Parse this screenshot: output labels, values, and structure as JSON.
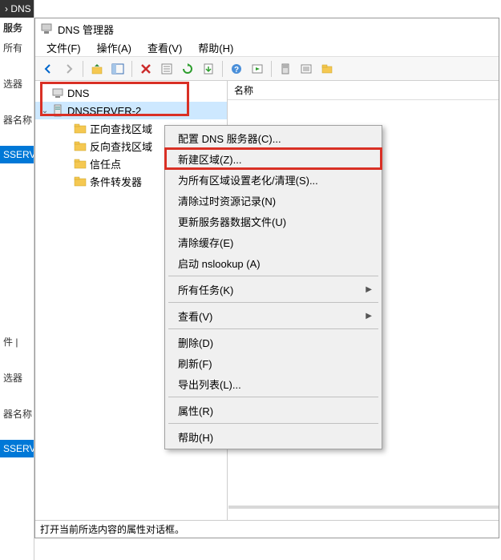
{
  "bg_sidebar": {
    "top": "› DNS",
    "items": [
      "服务",
      "所有",
      "",
      "选器",
      "",
      "器名称",
      "",
      "SSERV",
      "",
      "",
      "",
      "",
      "件 |",
      "",
      "选器",
      "",
      "器名称",
      "",
      "SSERV"
    ]
  },
  "window": {
    "title": "DNS 管理器",
    "menus": [
      "文件(F)",
      "操作(A)",
      "查看(V)",
      "帮助(H)"
    ]
  },
  "tree": {
    "root": "DNS",
    "server": "DNSSERVER-2",
    "children": [
      "正向查找区域",
      "反向查找区域",
      "信任点",
      "条件转发器"
    ]
  },
  "list": {
    "col1": "名称"
  },
  "context_menu": {
    "items": [
      {
        "label": "配置 DNS 服务器(C)..."
      },
      {
        "label": "新建区域(Z)..."
      },
      {
        "label": "为所有区域设置老化/清理(S)..."
      },
      {
        "label": "清除过时资源记录(N)"
      },
      {
        "label": "更新服务器数据文件(U)"
      },
      {
        "label": "清除缓存(E)"
      },
      {
        "label": "启动 nslookup (A)"
      },
      {
        "divider": true
      },
      {
        "label": "所有任务(K)",
        "submenu": true
      },
      {
        "divider": true
      },
      {
        "label": "查看(V)",
        "submenu": true
      },
      {
        "divider": true
      },
      {
        "label": "删除(D)"
      },
      {
        "label": "刷新(F)"
      },
      {
        "label": "导出列表(L)..."
      },
      {
        "divider": true
      },
      {
        "label": "属性(R)"
      },
      {
        "divider": true
      },
      {
        "label": "帮助(H)"
      }
    ]
  },
  "status": "打开当前所选内容的属性对话框。"
}
